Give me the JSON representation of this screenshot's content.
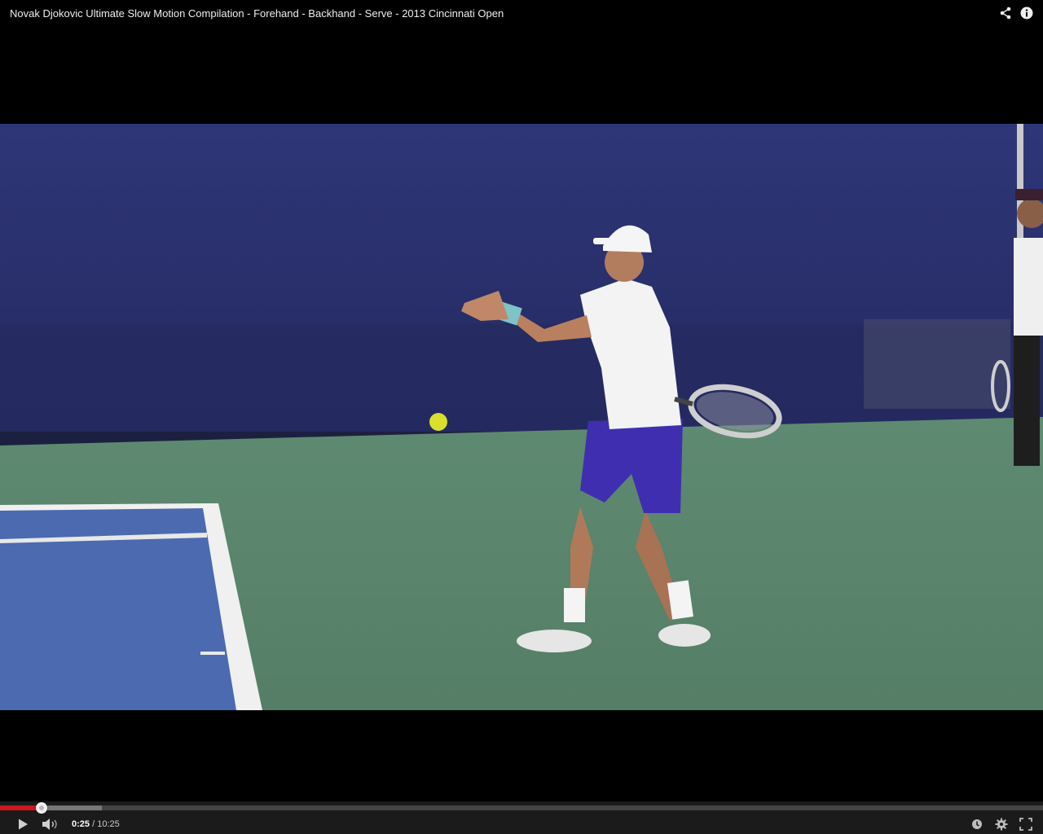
{
  "video": {
    "title": "Novak Djokovic Ultimate Slow Motion Compilation - Forehand - Backhand - Serve - 2013 Cincinnati Open"
  },
  "title_icons": [
    "share-icon",
    "info-icon"
  ],
  "player": {
    "current_time": "0:25",
    "separator": "/",
    "duration": "10:25",
    "progress_fraction": 0.04,
    "buffered_fraction": 0.098,
    "colors": {
      "played": "#cc181e",
      "buffered": "#777777",
      "track": "#444444"
    }
  },
  "control_icons": [
    "play-icon",
    "volume-icon",
    "watch-later-icon",
    "settings-icon",
    "fullscreen-icon"
  ]
}
